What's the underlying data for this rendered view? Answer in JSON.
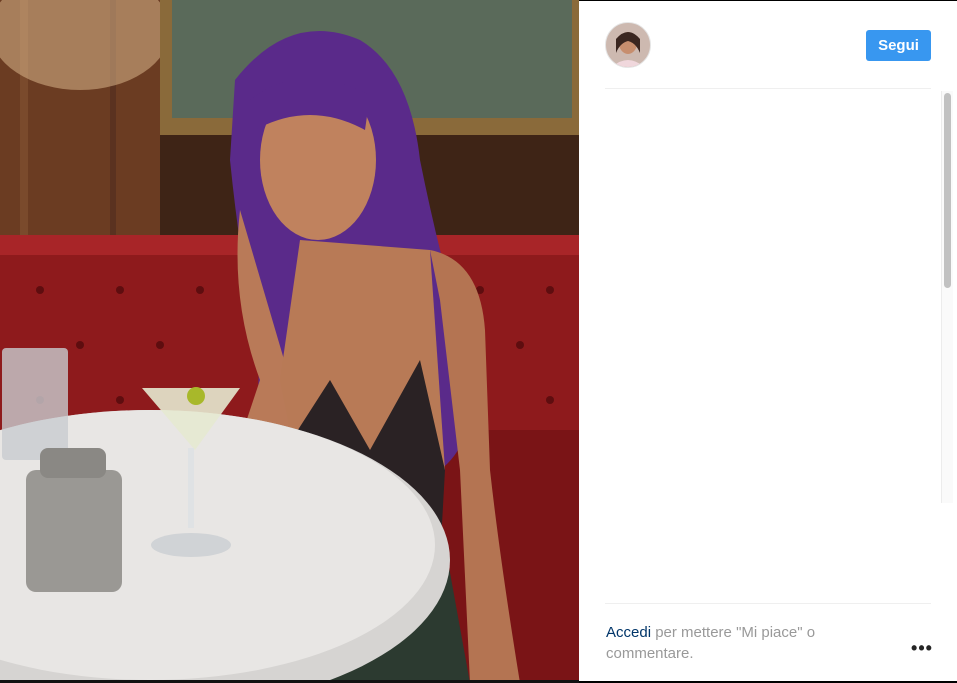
{
  "post": {
    "photo_description_icon": "post-photo",
    "author_avatar_icon": "profile-avatar"
  },
  "header": {
    "follow_label": "Segui"
  },
  "footer": {
    "login_link_label": "Accedi",
    "login_prompt_text": " per mettere \"Mi piace\" o commentare.",
    "more_options_label": "•••"
  },
  "colors": {
    "follow_button": "#3897f0",
    "login_link": "#003569",
    "muted_text": "#999999"
  }
}
